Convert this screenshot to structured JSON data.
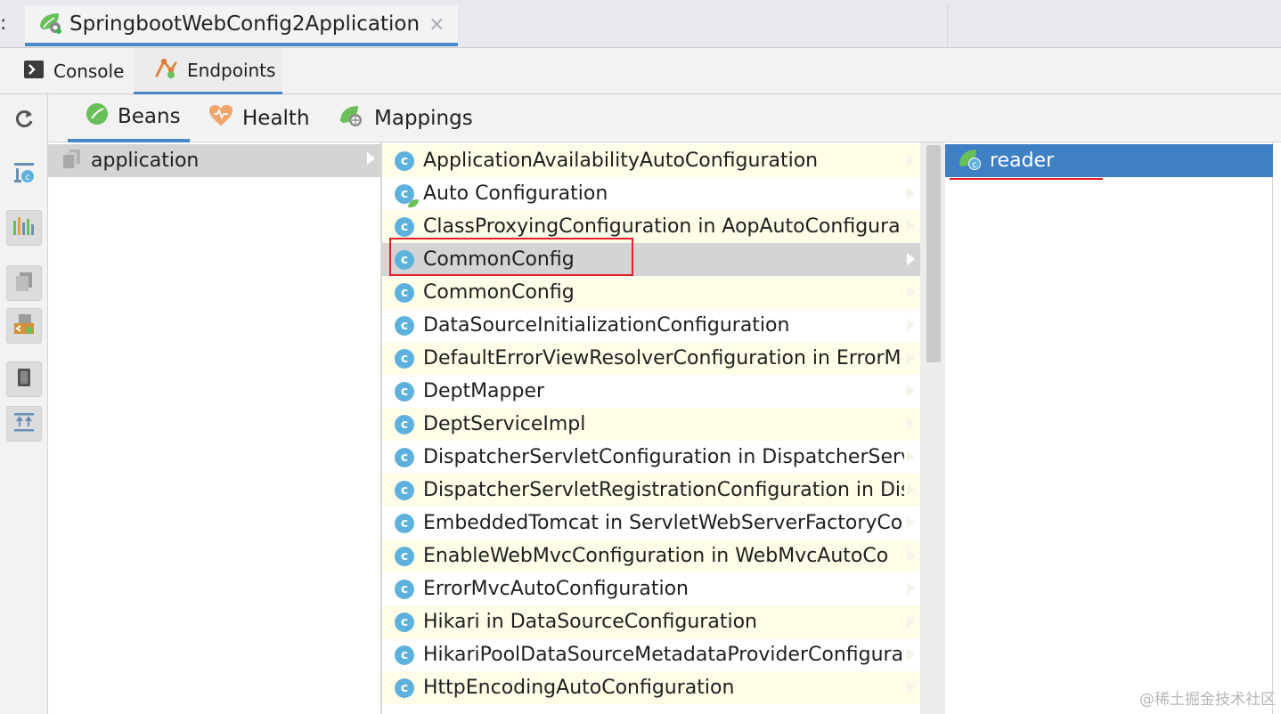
{
  "run_bar": {
    "prefix": ":",
    "tab_title": "SpringbootWebConfig2Application",
    "close_glyph": "×"
  },
  "sub_tabs": {
    "console": "Console",
    "endpoints": "Endpoints"
  },
  "endpoint_tabs": {
    "beans": "Beans",
    "health": "Health",
    "mappings": "Mappings"
  },
  "contexts": [
    {
      "label": "application"
    }
  ],
  "beans": [
    {
      "label": "ApplicationAvailabilityAutoConfiguration"
    },
    {
      "label": "Auto Configuration"
    },
    {
      "label": "ClassProxyingConfiguration in AopAutoConfigura"
    },
    {
      "label": "CommonConfig"
    },
    {
      "label": "CommonConfig"
    },
    {
      "label": "DataSourceInitializationConfiguration"
    },
    {
      "label": "DefaultErrorViewResolverConfiguration in ErrorM"
    },
    {
      "label": "DeptMapper"
    },
    {
      "label": "DeptServiceImpl"
    },
    {
      "label": "DispatcherServletConfiguration in DispatcherServ"
    },
    {
      "label": "DispatcherServletRegistrationConfiguration in Dis"
    },
    {
      "label": "EmbeddedTomcat in ServletWebServerFactoryCo"
    },
    {
      "label": "EnableWebMvcConfiguration in WebMvcAutoCo"
    },
    {
      "label": "ErrorMvcAutoConfiguration"
    },
    {
      "label": "Hikari in DataSourceConfiguration"
    },
    {
      "label": "HikariPoolDataSourceMetadataProviderConfigura"
    },
    {
      "label": "HttpEncodingAutoConfiguration"
    }
  ],
  "selected_bean_index": 3,
  "bean_icon_glyph": "c",
  "dependencies": [
    {
      "label": "reader"
    }
  ],
  "watermark": "@稀土掘金技术社区",
  "colors": {
    "accent": "#4a88c7",
    "selection": "#3f7fc4",
    "highlight_box": "#e0202a",
    "bean_icon": "#5fb1dd",
    "spring_green": "#6abf5a"
  },
  "icons": {
    "run_tab": "spring-boot-icon",
    "console": "console-icon",
    "endpoints": "endpoints-icon",
    "beans": "spring-leaf-icon",
    "health": "heart-icon",
    "mappings": "mappings-icon",
    "toolbar": [
      "refresh-icon",
      "show-library-beans-icon",
      "diagram-icon",
      "copy-icon",
      "navigate-icon",
      "export-icon",
      "collapse-icon"
    ]
  }
}
